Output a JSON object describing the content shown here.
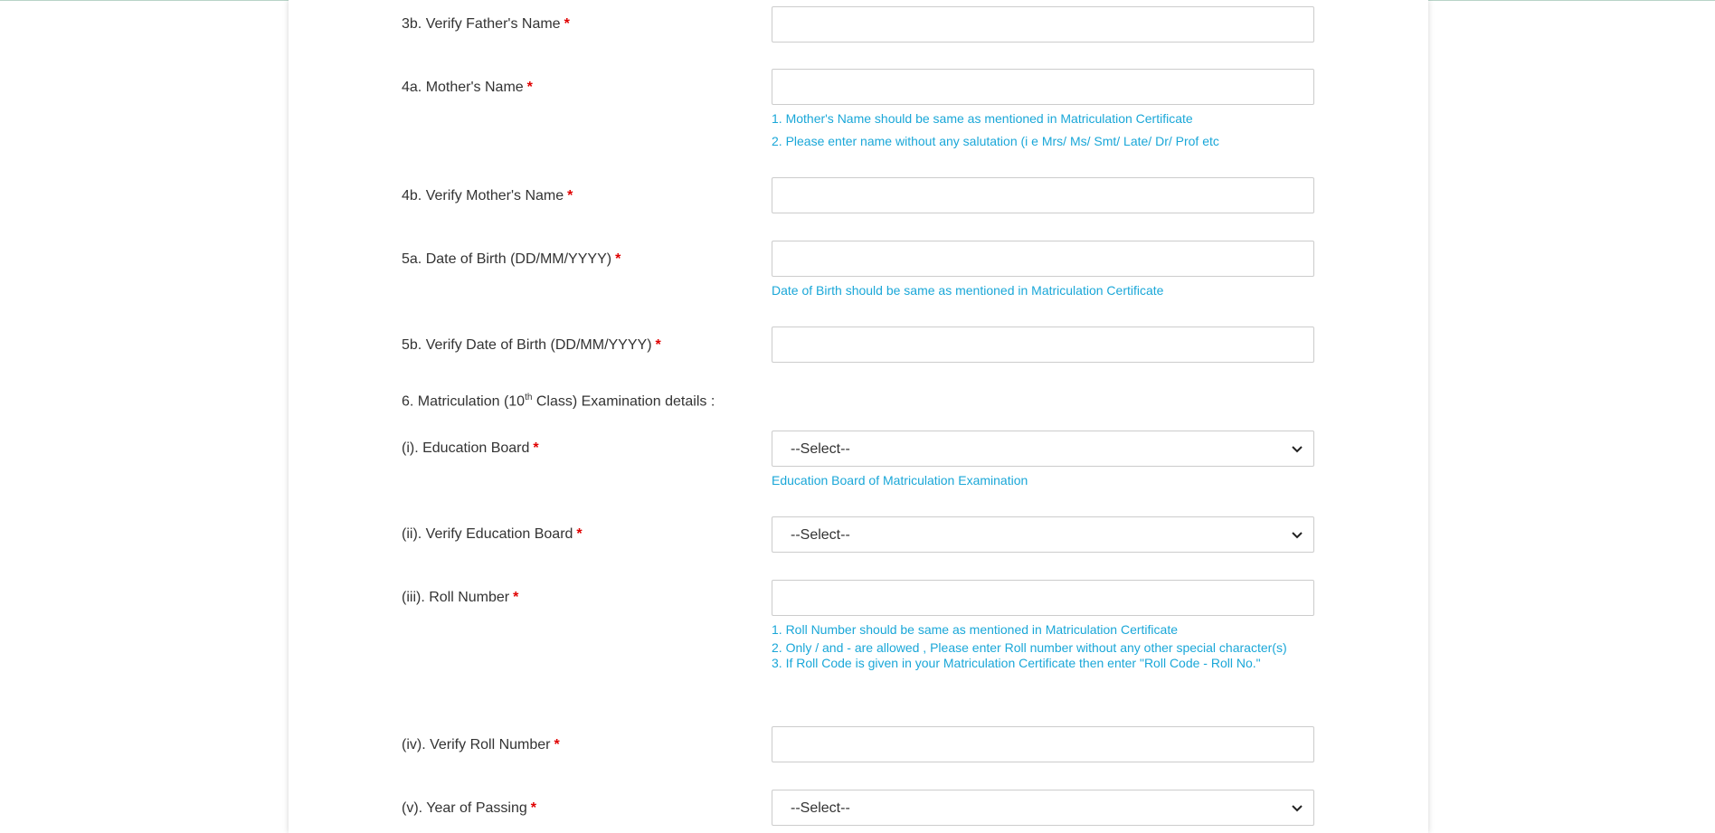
{
  "form": {
    "father_verify": {
      "label": "3b. Verify Father's Name",
      "required": "*",
      "value": ""
    },
    "mother_name": {
      "label": "4a. Mother's Name",
      "required": "*",
      "value": "",
      "hints": [
        "1. Mother's Name should be same as mentioned in Matriculation Certificate",
        "2. Please enter name without any salutation (i e Mrs/ Ms/ Smt/ Late/ Dr/ Prof etc"
      ]
    },
    "mother_verify": {
      "label": "4b. Verify Mother's Name",
      "required": "*",
      "value": ""
    },
    "dob": {
      "label": "5a. Date of Birth (DD/MM/YYYY)",
      "required": "*",
      "value": "",
      "hint": "Date of Birth should be same as mentioned in Matriculation Certificate"
    },
    "dob_verify": {
      "label": "5b. Verify Date of Birth (DD/MM/YYYY)",
      "required": "*",
      "value": ""
    },
    "matric_section": {
      "prefix": "6. Matriculation (10",
      "sup": "th",
      "suffix": " Class) Examination details :"
    },
    "board": {
      "label": "(i). Education Board",
      "required": "*",
      "selected": "--Select--",
      "hint": "Education Board of Matriculation Examination"
    },
    "board_verify": {
      "label": "(ii). Verify Education Board",
      "required": "*",
      "selected": "--Select--"
    },
    "roll": {
      "label": "(iii). Roll Number",
      "required": "*",
      "value": "",
      "hints": [
        "1. Roll Number should be same as mentioned in Matriculation Certificate",
        "2. Only / and - are allowed , Please enter Roll number without any other special character(s)",
        "3. If Roll Code is given in your Matriculation Certificate then enter \"Roll Code - Roll No.\""
      ]
    },
    "roll_verify": {
      "label": "(iv). Verify Roll Number",
      "required": "*",
      "value": ""
    },
    "year": {
      "label": "(v). Year of Passing",
      "required": "*",
      "selected": "--Select--"
    }
  },
  "colors": {
    "required": "#e00000",
    "hint": "#1aa7d8",
    "label": "#333333"
  }
}
